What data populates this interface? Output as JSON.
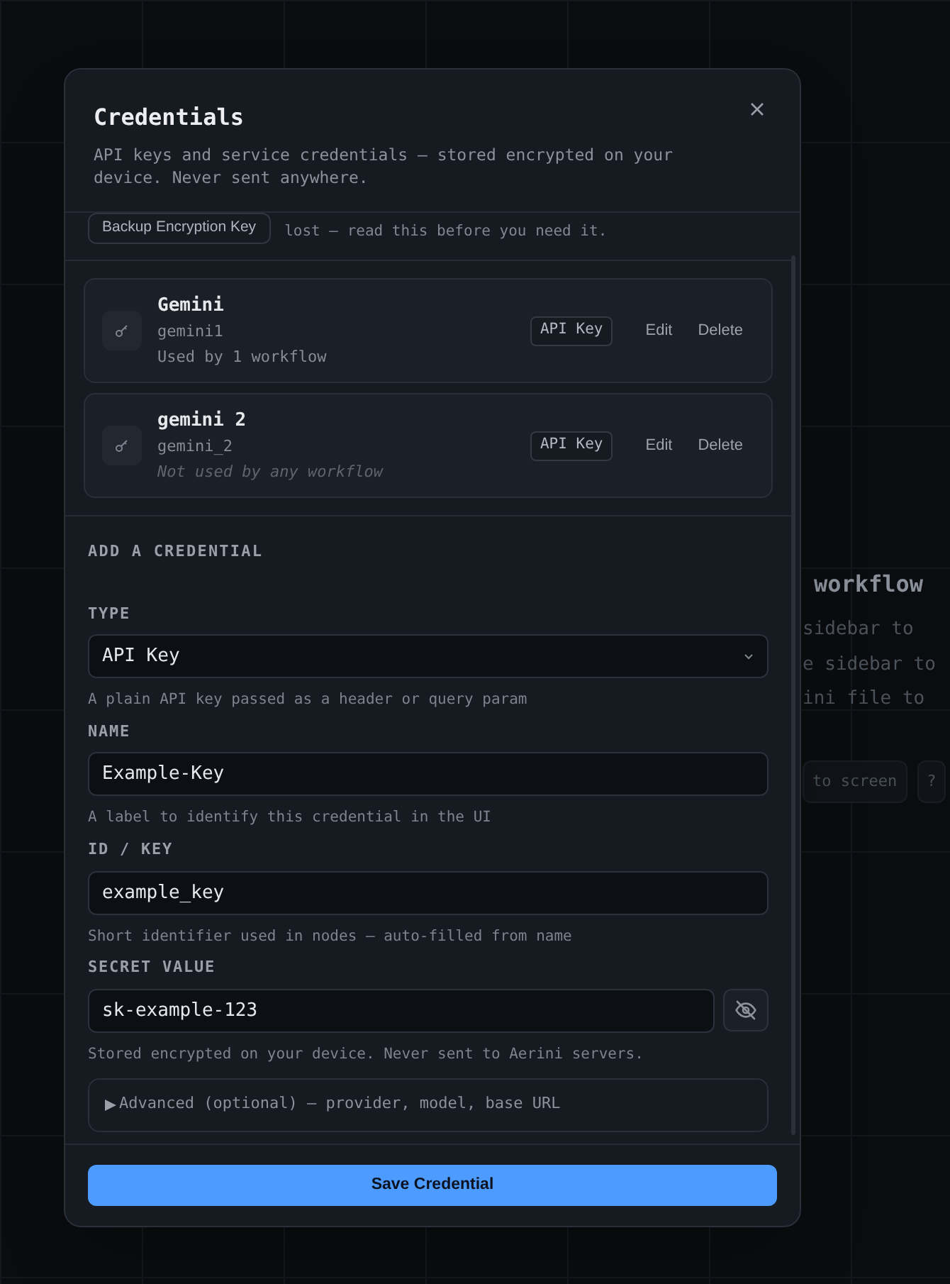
{
  "background": {
    "heading": "workflow",
    "lines": [
      "sidebar to",
      "e sidebar to",
      "ini file to"
    ],
    "buttons": [
      "to screen",
      "?"
    ]
  },
  "dialog": {
    "title": "Credentials",
    "description": "API keys and service credentials — stored encrypted on your device. Never sent anywhere.",
    "backup": {
      "button": "Backup Encryption Key",
      "note": "lost — read this before you need it."
    },
    "credentials": [
      {
        "name": "Gemini",
        "id": "gemini1",
        "usage": "Used by 1 workflow",
        "used": true,
        "type": "API Key",
        "actions": [
          "Edit",
          "Delete"
        ]
      },
      {
        "name": "gemini 2",
        "id": "gemini_2",
        "usage": "Not used by any workflow",
        "used": false,
        "type": "API Key",
        "actions": [
          "Edit",
          "Delete"
        ]
      }
    ],
    "add": {
      "heading": "ADD A CREDENTIAL",
      "fields": [
        {
          "kind": "select",
          "label": "TYPE",
          "value": "API Key",
          "hint": "A plain API key passed as a header or query param"
        },
        {
          "kind": "text",
          "label": "NAME",
          "value": "Example-Key",
          "hint": "A label to identify this credential in the UI"
        },
        {
          "kind": "text",
          "label": "ID / KEY",
          "value": "example_key",
          "hint": "Short identifier used in nodes — auto-filled from name"
        },
        {
          "kind": "secret",
          "label": "SECRET VALUE",
          "value": "sk-example-123",
          "hint": "Stored encrypted on your device. Never sent to Aerini servers.",
          "revealed": true
        }
      ],
      "advanced": {
        "label": "Advanced (optional) — provider, model, base URL",
        "expanded": false
      }
    },
    "save_button": "Save Credential"
  }
}
